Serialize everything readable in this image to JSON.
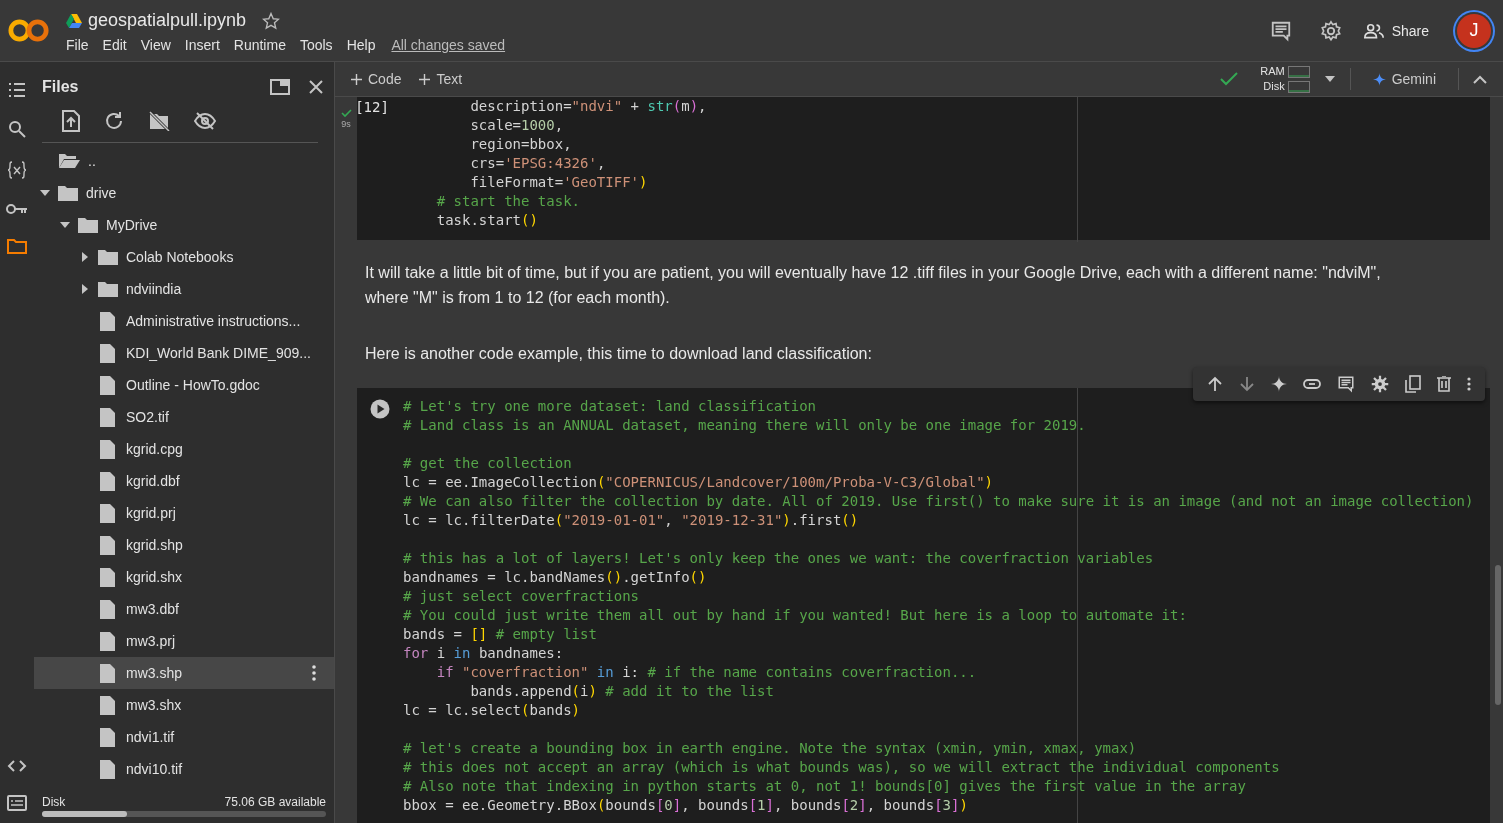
{
  "header": {
    "notebook_title": "geospatialpull.ipynb",
    "starred": false,
    "menu": [
      "File",
      "Edit",
      "View",
      "Insert",
      "Runtime",
      "Tools",
      "Help"
    ],
    "save_status": "All changes saved",
    "share": "Share",
    "avatar": "J"
  },
  "toolbar": {
    "add_buttons": [
      "Code",
      "Text"
    ],
    "ram_label": "RAM",
    "disk_label": "Disk",
    "gemini": "Gemini"
  },
  "sidebar": {
    "title": "Files",
    "tree": [
      {
        "name": "..",
        "kind": "parent",
        "selected": false
      },
      {
        "name": "drive",
        "kind": "folder",
        "expanded": true,
        "selected": false,
        "children": [
          {
            "name": "MyDrive",
            "kind": "folder",
            "expanded": true,
            "selected": false,
            "children": [
              {
                "name": "Colab Notebooks",
                "kind": "folder",
                "expanded": false,
                "selected": false
              },
              {
                "name": "ndviindia",
                "kind": "folder",
                "expanded": false,
                "selected": false
              },
              {
                "name": "Administrative instructions...",
                "kind": "file",
                "selected": false
              },
              {
                "name": "KDI_World Bank DIME_909...",
                "kind": "file",
                "selected": false
              },
              {
                "name": "Outline - HowTo.gdoc",
                "kind": "file",
                "selected": false
              },
              {
                "name": "SO2.tif",
                "kind": "file",
                "selected": false
              },
              {
                "name": "kgrid.cpg",
                "kind": "file",
                "selected": false
              },
              {
                "name": "kgrid.dbf",
                "kind": "file",
                "selected": false
              },
              {
                "name": "kgrid.prj",
                "kind": "file",
                "selected": false
              },
              {
                "name": "kgrid.shp",
                "kind": "file",
                "selected": false
              },
              {
                "name": "kgrid.shx",
                "kind": "file",
                "selected": false
              },
              {
                "name": "mw3.dbf",
                "kind": "file",
                "selected": false
              },
              {
                "name": "mw3.prj",
                "kind": "file",
                "selected": false
              },
              {
                "name": "mw3.shp",
                "kind": "file",
                "selected": true
              },
              {
                "name": "mw3.shx",
                "kind": "file",
                "selected": false
              },
              {
                "name": "ndvi1.tif",
                "kind": "file",
                "selected": false
              },
              {
                "name": "ndvi10.tif",
                "kind": "file",
                "selected": false
              }
            ]
          }
        ]
      }
    ],
    "disk": {
      "label": "Disk",
      "available": "75.06 GB available",
      "level": 0.3
    }
  },
  "cells": [
    {
      "kind": "code",
      "executed": true,
      "exec_count": "[12]",
      "duration": "9s",
      "lines": [
        {
          "kind": "code",
          "tokens": [
            {
              "kind": "t",
              "text": "        description="
            },
            {
              "kind": "s",
              "text": "\"ndvi\""
            },
            {
              "kind": "t",
              "text": " + "
            },
            {
              "kind": "b",
              "text": "str"
            },
            {
              "kind": "p2",
              "text": "("
            },
            {
              "kind": "t",
              "text": "m"
            },
            {
              "kind": "p2",
              "text": ")"
            },
            {
              "kind": "t",
              "text": ","
            }
          ]
        },
        {
          "kind": "code",
          "tokens": [
            {
              "kind": "t",
              "text": "        scale="
            },
            {
              "kind": "n",
              "text": "1000"
            },
            {
              "kind": "t",
              "text": ","
            }
          ]
        },
        {
          "kind": "code",
          "tokens": [
            {
              "kind": "t",
              "text": "        region=bbox,"
            }
          ]
        },
        {
          "kind": "code",
          "tokens": [
            {
              "kind": "t",
              "text": "        crs="
            },
            {
              "kind": "s",
              "text": "'EPSG:4326'"
            },
            {
              "kind": "t",
              "text": ","
            }
          ]
        },
        {
          "kind": "code",
          "tokens": [
            {
              "kind": "t",
              "text": "        fileFormat="
            },
            {
              "kind": "s",
              "text": "'GeoTIFF'"
            },
            {
              "kind": "p1",
              "text": ")"
            }
          ]
        },
        {
          "kind": "code",
          "tokens": [
            {
              "kind": "c",
              "text": "    # start the task."
            }
          ]
        },
        {
          "kind": "code",
          "tokens": [
            {
              "kind": "t",
              "text": "    task.start"
            },
            {
              "kind": "p1",
              "text": "()"
            }
          ]
        }
      ]
    },
    {
      "kind": "text",
      "paragraphs": [
        "It will take a little bit of time, but if you are patient, you will eventually have 12 .tiff files in your Google Drive, each with a different name: \"ndviM\", where \"M\" is from 1 to 12 (for each month).",
        "Here is another code example, this time to download land classification:"
      ]
    },
    {
      "kind": "code",
      "executed": false,
      "focused": true,
      "lines": [
        {
          "kind": "code",
          "tokens": [
            {
              "kind": "c",
              "text": "# Let's try one more dataset: land classification"
            }
          ]
        },
        {
          "kind": "code",
          "tokens": [
            {
              "kind": "c",
              "text": "# Land class is an ANNUAL dataset, meaning there will only be one image for 2019."
            }
          ]
        },
        {
          "kind": "blank"
        },
        {
          "kind": "code",
          "tokens": [
            {
              "kind": "c",
              "text": "# get the collection"
            }
          ]
        },
        {
          "kind": "code",
          "tokens": [
            {
              "kind": "t",
              "text": "lc = ee.ImageCollection"
            },
            {
              "kind": "p1",
              "text": "("
            },
            {
              "kind": "s",
              "text": "\"COPERNICUS/Landcover/100m/Proba-V-C3/Global\""
            },
            {
              "kind": "p1",
              "text": ")"
            }
          ]
        },
        {
          "kind": "code",
          "tokens": [
            {
              "kind": "c",
              "text": "# We can also filter the collection by date. All of 2019. Use first() to make sure it is an image (and not an image collection)"
            }
          ]
        },
        {
          "kind": "code",
          "tokens": [
            {
              "kind": "t",
              "text": "lc = lc.filterDate"
            },
            {
              "kind": "p1",
              "text": "("
            },
            {
              "kind": "s",
              "text": "\"2019-01-01\""
            },
            {
              "kind": "t",
              "text": ", "
            },
            {
              "kind": "s",
              "text": "\"2019-12-31\""
            },
            {
              "kind": "p1",
              "text": ")"
            },
            {
              "kind": "t",
              "text": ".first"
            },
            {
              "kind": "p1",
              "text": "()"
            }
          ]
        },
        {
          "kind": "blank"
        },
        {
          "kind": "code",
          "tokens": [
            {
              "kind": "c",
              "text": "# this has a lot of layers! Let's only keep the ones we want: the coverfraction variables"
            }
          ]
        },
        {
          "kind": "code",
          "tokens": [
            {
              "kind": "t",
              "text": "bandnames = lc.bandNames"
            },
            {
              "kind": "p1",
              "text": "()"
            },
            {
              "kind": "t",
              "text": ".getInfo"
            },
            {
              "kind": "p1",
              "text": "()"
            }
          ]
        },
        {
          "kind": "code",
          "tokens": [
            {
              "kind": "c",
              "text": "# just select coverfractions"
            }
          ]
        },
        {
          "kind": "code",
          "tokens": [
            {
              "kind": "c",
              "text": "# You could just write them all out by hand if you wanted! But here is a loop to automate it:"
            }
          ]
        },
        {
          "kind": "code",
          "tokens": [
            {
              "kind": "t",
              "text": "bands = "
            },
            {
              "kind": "p1",
              "text": "[]"
            },
            {
              "kind": "c",
              "text": " # empty list"
            }
          ]
        },
        {
          "kind": "code",
          "tokens": [
            {
              "kind": "k",
              "text": "for"
            },
            {
              "kind": "t",
              "text": " i "
            },
            {
              "kind": "o",
              "text": "in"
            },
            {
              "kind": "t",
              "text": " bandnames:"
            }
          ]
        },
        {
          "kind": "code",
          "tokens": [
            {
              "kind": "k",
              "text": "    if"
            },
            {
              "kind": "s",
              "text": " \"coverfraction\""
            },
            {
              "kind": "o",
              "text": " in"
            },
            {
              "kind": "t",
              "text": " i: "
            },
            {
              "kind": "c",
              "text": "# if the name contains coverfraction..."
            }
          ]
        },
        {
          "kind": "code",
          "tokens": [
            {
              "kind": "t",
              "text": "        bands.append"
            },
            {
              "kind": "p1",
              "text": "("
            },
            {
              "kind": "t",
              "text": "i"
            },
            {
              "kind": "p1",
              "text": ")"
            },
            {
              "kind": "c",
              "text": " # add it to the list"
            }
          ]
        },
        {
          "kind": "code",
          "tokens": [
            {
              "kind": "t",
              "text": "lc = lc.select"
            },
            {
              "kind": "p1",
              "text": "("
            },
            {
              "kind": "t",
              "text": "bands"
            },
            {
              "kind": "p1",
              "text": ")"
            }
          ]
        },
        {
          "kind": "blank"
        },
        {
          "kind": "code",
          "tokens": [
            {
              "kind": "c",
              "text": "# let's create a bounding box in earth engine. Note the syntax (xmin, ymin, xmax, ymax)"
            }
          ]
        },
        {
          "kind": "code",
          "tokens": [
            {
              "kind": "c",
              "text": "# this does not accept an array (which is what bounds was), so we will extract the individual components"
            }
          ]
        },
        {
          "kind": "code",
          "tokens": [
            {
              "kind": "c",
              "text": "# Also note that indexing in python starts at 0, not 1! bounds[0] gives the first value in the array"
            }
          ]
        },
        {
          "kind": "code",
          "tokens": [
            {
              "kind": "t",
              "text": "bbox = ee.Geometry.BBox"
            },
            {
              "kind": "p1",
              "text": "("
            },
            {
              "kind": "t",
              "text": "bounds"
            },
            {
              "kind": "p2",
              "text": "["
            },
            {
              "kind": "n",
              "text": "0"
            },
            {
              "kind": "p2",
              "text": "]"
            },
            {
              "kind": "t",
              "text": ", bounds"
            },
            {
              "kind": "p2",
              "text": "["
            },
            {
              "kind": "n",
              "text": "1"
            },
            {
              "kind": "p2",
              "text": "]"
            },
            {
              "kind": "t",
              "text": ", bounds"
            },
            {
              "kind": "p2",
              "text": "["
            },
            {
              "kind": "n",
              "text": "2"
            },
            {
              "kind": "p2",
              "text": "]"
            },
            {
              "kind": "t",
              "text": ", bounds"
            },
            {
              "kind": "p2",
              "text": "["
            },
            {
              "kind": "n",
              "text": "3"
            },
            {
              "kind": "p2",
              "text": "]"
            },
            {
              "kind": "p1",
              "text": ")"
            }
          ]
        }
      ]
    }
  ]
}
